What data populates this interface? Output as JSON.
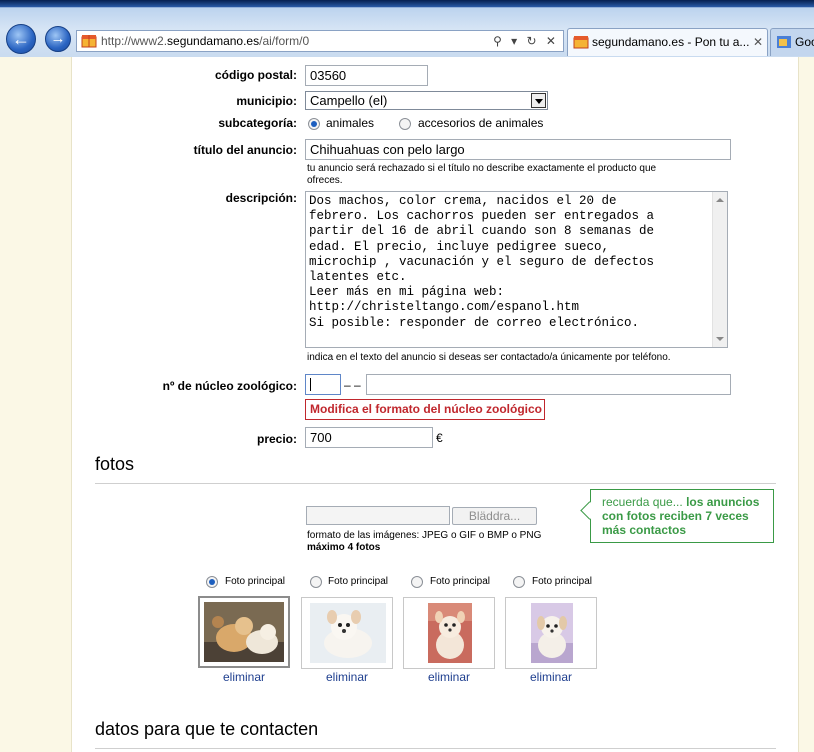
{
  "browser": {
    "url_prefix": "http://www2.",
    "url_domain": "segundamano.es",
    "url_path": "/ai/form/0",
    "addr_controls": "⚲ ▾ ↻ ✕",
    "tabs": [
      {
        "label": "segundamano.es - Pon tu a...",
        "close": "✕"
      },
      {
        "label": "Goo"
      }
    ]
  },
  "form": {
    "postal": {
      "label": "código postal:",
      "value": "03560"
    },
    "municipio": {
      "label": "municipio:",
      "value": "Campello (el)"
    },
    "subcategoria": {
      "label": "subcategoría:",
      "options": [
        "animales",
        "accesorios de animales"
      ],
      "selected": "animales"
    },
    "titulo": {
      "label": "título del anuncio:",
      "value": "Chihuahuas con pelo largo",
      "hint_line1": "tu anuncio será rechazado si el título no describe exactamente el producto que",
      "hint_line2": "ofreces."
    },
    "descripcion": {
      "label": "descripción:",
      "value": "Dos machos, color crema, nacidos el 20 de\nfebrero. Los cachorros pueden ser entregados a\npartir del 16 de abril cuando son 8 semanas de\nedad. El precio, incluye pedigree sueco,\nmicrochip , vacunación y el seguro de defectos\nlatentes etc.\nLeer más en mi página web:\nhttp://christeltango.com/espanol.htm\nSi posible: responder de correo electrónico.",
      "hint": "indica en el texto del anuncio si deseas ser contactado/a únicamente por teléfono."
    },
    "nucleo": {
      "label": "nº de núcleo zoológico:",
      "separator": "– –",
      "error": "Modifica el formato del núcleo zoológico"
    },
    "precio": {
      "label": "precio:",
      "value": "700",
      "currency": "€"
    }
  },
  "fotos": {
    "heading": "fotos",
    "browse_button": "Bläddra...",
    "format_hint": "formato de las imágenes: JPEG o GIF o BMP o PNG",
    "max_hint": "máximo 4 fotos",
    "tip_prefix": "recuerda que... ",
    "tip_bold_1": "los anuncios",
    "tip_bold_2": "con fotos reciben 7 veces",
    "tip_bold_3": "más contactos",
    "principal_label": "Foto principal",
    "delete_label": "eliminar",
    "selected_principal_index": 0,
    "thumbnails": [
      {
        "principal_label": "Foto principal",
        "delete_label": "eliminar"
      },
      {
        "principal_label": "Foto principal",
        "delete_label": "eliminar"
      },
      {
        "principal_label": "Foto principal",
        "delete_label": "eliminar"
      },
      {
        "principal_label": "Foto principal",
        "delete_label": "eliminar"
      }
    ]
  },
  "contact": {
    "heading": "datos para que te contacten"
  },
  "colors": {
    "error": "#c0272d",
    "tip_green": "#3a9a46",
    "link": "#1f3f8f",
    "page_band": "#fbf8e6"
  }
}
